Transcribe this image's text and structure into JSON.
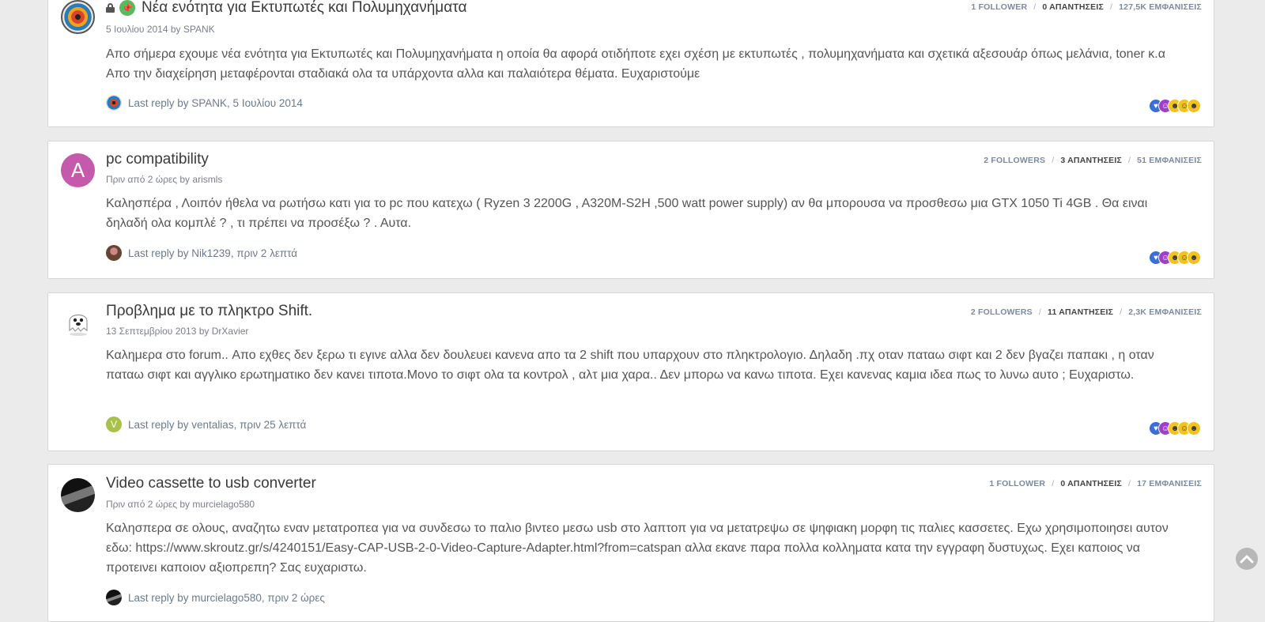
{
  "topics": [
    {
      "title": "Νέα ενότητα για Εκτυπωτές και Πολυμηχανήματα",
      "meta": "5 Ιουλίου 2014 by SPANK",
      "excerpt": "Απο σήμερα εχουμε νέα ενότητα για Εκτυπωτές και Πολυμηχανήματα η οποία θα αφορά οτιδήποτε εχει σχέση με εκτυπωτές , πολυμηχανήματα και σχετικά αξεσουάρ όπως μελάνια, toner κ.α Απο την διαχείρηση μεταφέρονται σταδιακά ολα τα υπάρχοντα αλλα και παλαιότερα θέματα. Ευχαριστούμε",
      "last_reply": "Last reply by SPANK, 5 Ιουλίου 2014",
      "followers": "1 FOLLOWER",
      "replies": "0 ΑΠΑΝΤΗΣΕΙΣ",
      "views": "127,5K ΕΜΦΑΝΙΣΕΙΣ"
    },
    {
      "title": "pc compatibility",
      "avatar_letter": "A",
      "meta": "Πριν από 2 ώρες by arismls",
      "excerpt": "Καλησπέρα , Λοιπόν ήθελα να ρωτήσω κατι για το pc που κατεχω ( Ryzen 3 2200G , A320M-S2H ,500 watt power supply) αν θα μπορουσα να προσθεσω μια GTX 1050 Ti 4GB . Θα ειναι δηλαδή ολα κομπλέ ? , τι πρέπει να προσέξω ? . Αυτα.",
      "last_reply": "Last reply by Nik1239, πριν 2 λεπτά",
      "followers": "2 FOLLOWERS",
      "replies": "3 ΑΠΑΝΤΗΣΕΙΣ",
      "views": "51 ΕΜΦΑΝΙΣΕΙΣ"
    },
    {
      "title": "Προβλημα με το πληκτρο Shift.",
      "meta": "13 Σεπτεμβρίου 2013 by DrXavier",
      "excerpt": "Καλημερα στο forum.. Απο εχθες δεν ξερω τι εγινε αλλα δεν δουλευει κανενα απο τα 2 shift που υπαρχουν στο πληκτρολογιο. Δηλαδη .πχ οταν παταω σιφτ και 2 δεν βγαζει παπακι , η οταν παταω σιφτ και αγγλικο ερωτηματικο δεν κανει τιποτα.Μονο το σιφτ ολα τα κοντρολ , αλτ μια χαρα.. Δεν μπορω να κανω τιποτα. Εχει κανενας καμια ιδεα πως το λυνω αυτο ; Ευχαριστω.",
      "last_reply_avatar_letter": "V",
      "last_reply": "Last reply by ventalias, πριν 25 λεπτά",
      "followers": "2 FOLLOWERS",
      "replies": "11 ΑΠΑΝΤΗΣΕΙΣ",
      "views": "2,3K ΕΜΦΑΝΙΣΕΙΣ"
    },
    {
      "title": "Video cassette to usb converter",
      "meta": "Πριν από 2 ώρες by murcielago580",
      "excerpt": "Καλησπερα σε ολους, αναζητω εναν μετατροπεα για να συνδεσω το παλιο βιντεο μεσω usb στο λαπτοπ για να μετατρεψω σε ψηφιακη μορφη τις παλιες κασσετες. Εχω χρησιμοποιησει αυτον εδω: https://www.skroutz.gr/s/4240151/Easy-CAP-USB-2-0-Video-Capture-Adapter.html?from=catspan αλλα εκανε παρα πολλα κολληματα κατα την εγγραφη δυστυχως. Εχει καποιος να προτεινει καποιον αξιοπρεπη? Σας ευχαριστω.",
      "last_reply": "Last reply by murcielago580, πριν 2 ώρες",
      "followers": "1 FOLLOWER",
      "replies": "0 ΑΠΑΝΤΗΣΕΙΣ",
      "views": "17 ΕΜΦΑΝΙΣΕΙΣ"
    }
  ],
  "stat_separator": "/",
  "reaction_icons": [
    "like-icon",
    "love-icon",
    "haha-icon",
    "wow-icon",
    "lol-icon"
  ],
  "colors": {
    "pinned_badge": "#5cb85c",
    "avatar_a": "#c55aac",
    "avatar_v": "#a6c24a"
  }
}
